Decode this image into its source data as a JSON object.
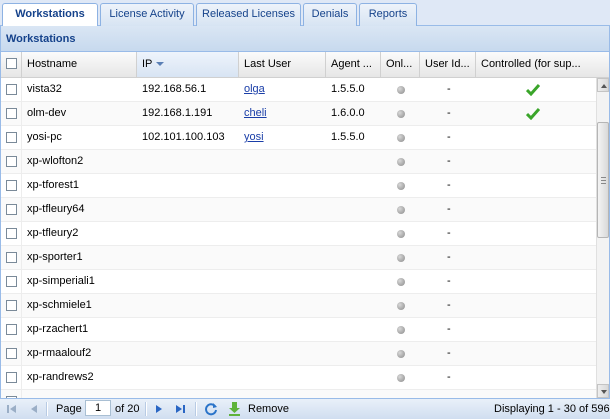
{
  "tabs": [
    {
      "label": "Workstations",
      "active": true
    },
    {
      "label": "License Activity"
    },
    {
      "label": "Released Licenses"
    },
    {
      "label": "Denials"
    },
    {
      "label": "Reports"
    }
  ],
  "panel_title": "Workstations",
  "columns": [
    "Hostname",
    "IP",
    "Last User",
    "Agent ...",
    "Onl...",
    "User Id...",
    "Controlled (for sup..."
  ],
  "rows": [
    {
      "host": "vista32",
      "ip": "192.168.56.1",
      "user": "olga",
      "agent": "1.5.5.0",
      "uid": "-",
      "controlled": true
    },
    {
      "host": "olm-dev",
      "ip": "192.168.1.191",
      "user": "cheli",
      "agent": "1.6.0.0",
      "uid": "-",
      "controlled": true
    },
    {
      "host": "yosi-pc",
      "ip": "102.101.100.103",
      "user": "yosi",
      "agent": "1.5.5.0",
      "uid": "-",
      "controlled": false
    },
    {
      "host": "xp-wlofton2",
      "ip": "",
      "user": "",
      "agent": "",
      "uid": "-",
      "controlled": false
    },
    {
      "host": "xp-tforest1",
      "ip": "",
      "user": "",
      "agent": "",
      "uid": "-",
      "controlled": false
    },
    {
      "host": "xp-tfleury64",
      "ip": "",
      "user": "",
      "agent": "",
      "uid": "-",
      "controlled": false
    },
    {
      "host": "xp-tfleury2",
      "ip": "",
      "user": "",
      "agent": "",
      "uid": "-",
      "controlled": false
    },
    {
      "host": "xp-sporter1",
      "ip": "",
      "user": "",
      "agent": "",
      "uid": "-",
      "controlled": false
    },
    {
      "host": "xp-simperiali1",
      "ip": "",
      "user": "",
      "agent": "",
      "uid": "-",
      "controlled": false
    },
    {
      "host": "xp-schmiele1",
      "ip": "",
      "user": "",
      "agent": "",
      "uid": "-",
      "controlled": false
    },
    {
      "host": "xp-rzachert1",
      "ip": "",
      "user": "",
      "agent": "",
      "uid": "-",
      "controlled": false
    },
    {
      "host": "xp-rmaalouf2",
      "ip": "",
      "user": "",
      "agent": "",
      "uid": "-",
      "controlled": false
    },
    {
      "host": "xp-randrews2",
      "ip": "",
      "user": "",
      "agent": "",
      "uid": "-",
      "controlled": false
    },
    {
      "host": "",
      "ip": "",
      "user": "",
      "agent": "",
      "uid": "",
      "controlled": false
    }
  ],
  "pager": {
    "page_label": "Page",
    "page_value": "1",
    "of_label": "of 20",
    "remove_label": "Remove",
    "display_text": "Displaying 1 - 30 of 596"
  },
  "colors": {
    "link": "#1a3ea8",
    "header_text": "#15428b",
    "check": "#3aa52a"
  }
}
